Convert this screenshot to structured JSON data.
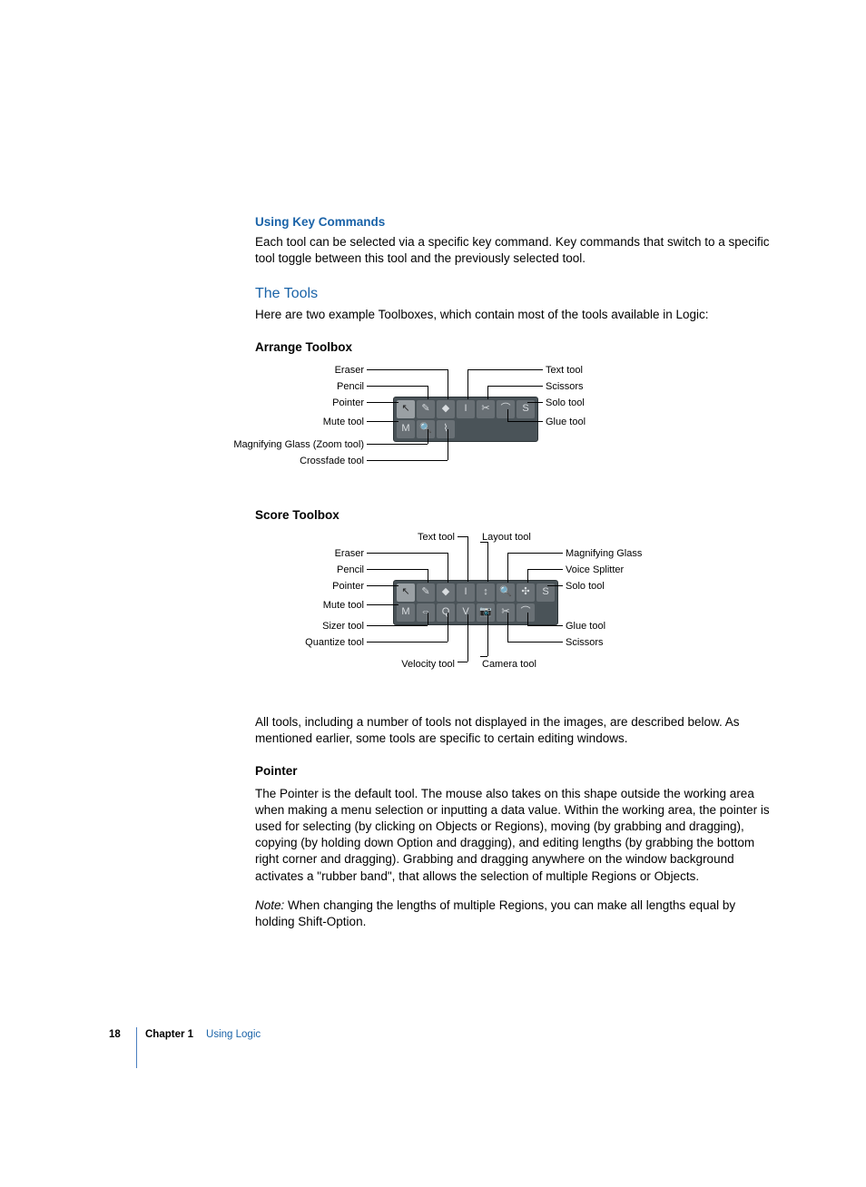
{
  "subheading1": "Using Key Commands",
  "para1": "Each tool can be selected via a specific key command. Key commands that switch to a specific tool toggle between this tool and the previously selected tool.",
  "heading_tools": "The Tools",
  "para_tools_intro": "Here are two example Toolboxes, which contain most of the tools available in Logic:",
  "arrange_heading": "Arrange Toolbox",
  "score_heading": "Score Toolbox",
  "arrange_labels": {
    "left": [
      "Eraser",
      "Pencil",
      "Pointer",
      "Mute tool",
      "Magnifying Glass (Zoom tool)",
      "Crossfade tool"
    ],
    "right": [
      "Text tool",
      "Scissors",
      "Solo tool",
      "Glue tool"
    ]
  },
  "score_labels": {
    "top": [
      "Text tool",
      "Layout tool"
    ],
    "left": [
      "Eraser",
      "Pencil",
      "Pointer",
      "Mute tool",
      "Sizer tool",
      "Quantize tool"
    ],
    "right": [
      "Magnifying Glass",
      "Voice Splitter",
      "Solo tool",
      "Glue tool",
      "Scissors"
    ],
    "bottom": [
      "Velocity tool",
      "Camera tool"
    ]
  },
  "para_below_diagrams": "All tools, including a number of tools not displayed in the images, are described below. As mentioned earlier, some tools are specific to certain editing windows.",
  "pointer_heading": "Pointer",
  "pointer_para": "The Pointer is the default tool. The mouse also takes on this shape outside the working area when making a menu selection or inputting a data value. Within the working area, the pointer is used for selecting (by clicking on Objects or Regions), moving (by grabbing and dragging), copying (by holding down Option and dragging), and editing lengths (by grabbing the bottom right corner and dragging). Grabbing and dragging anywhere on the window background activates a \"rubber band\", that allows the selection of multiple Regions or Objects.",
  "note_label": "Note:",
  "note_text": "When changing the lengths of multiple Regions, you can make all lengths equal by holding Shift-Option.",
  "footer": {
    "page": "18",
    "chapter": "Chapter 1",
    "title": "Using Logic"
  },
  "icons": {
    "arrange_row1": [
      "↖",
      "✎",
      "◆",
      "I",
      "✂",
      "⌒",
      "S"
    ],
    "arrange_row2": [
      "M",
      "🔍",
      "⌇"
    ],
    "score_row1": [
      "↖",
      "✎",
      "◆",
      "I",
      "↕",
      "🔍",
      "✣",
      "S"
    ],
    "score_row2": [
      "M",
      "⇔",
      "Q",
      "V",
      "📷",
      "✂",
      "⌒"
    ]
  }
}
